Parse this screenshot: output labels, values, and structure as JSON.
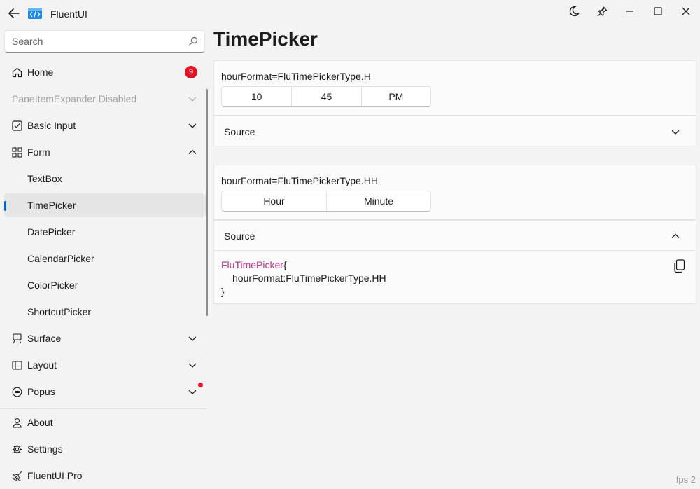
{
  "app": {
    "title": "FluentUI"
  },
  "search": {
    "placeholder": "Search"
  },
  "sidebar": {
    "home": {
      "label": "Home",
      "badge": "9"
    },
    "disabled": {
      "label": "PaneItemExpander Disabled"
    },
    "basic_input": {
      "label": "Basic Input"
    },
    "form": {
      "label": "Form"
    },
    "form_items": [
      "TextBox",
      "TimePicker",
      "DatePicker",
      "CalendarPicker",
      "ColorPicker",
      "ShortcutPicker"
    ],
    "selected_item": "TimePicker",
    "surface": {
      "label": "Surface"
    },
    "layout": {
      "label": "Layout"
    },
    "popus": {
      "label": "Popus"
    },
    "about": {
      "label": "About"
    },
    "settings": {
      "label": "Settings"
    },
    "pro": {
      "label": "FluentUI Pro"
    }
  },
  "main": {
    "title": "TimePicker",
    "example1": {
      "caption": "hourFormat=FluTimePickerType.H",
      "hour": "10",
      "minute": "45",
      "ampm": "PM",
      "source_label": "Source"
    },
    "example2": {
      "caption": "hourFormat=FluTimePickerType.HH",
      "hour": "Hour",
      "minute": "Minute",
      "source_label": "Source",
      "code": {
        "keyword": "FluTimePicker",
        "open": "{",
        "body": "hourFormat:FluTimePickerType.HH",
        "close": "}"
      }
    }
  },
  "status": {
    "fps": "fps 2"
  },
  "colors": {
    "accent": "#0067c0",
    "badge": "#e81123",
    "code_keyword": "#c0338b"
  }
}
